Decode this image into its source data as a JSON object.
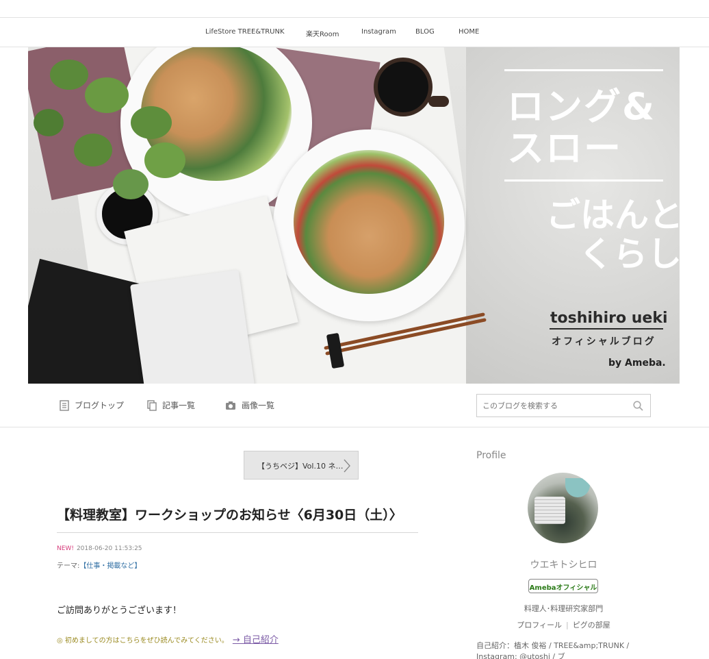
{
  "topnav": {
    "items": [
      "LifeStore TREE&TRUNK",
      "楽天Room",
      "Instagram",
      "BLOG",
      "HOME"
    ]
  },
  "hero": {
    "title_line1": "ロング&",
    "title_line2": "スロー",
    "title_line3": "ごはんと",
    "title_line4": "くらし",
    "author": "toshihiro ueki",
    "blog_label": "オフィシャルブログ",
    "by_label": "by Ameba."
  },
  "subnav": {
    "blog_top": "ブログトップ",
    "articles": "記事一覧",
    "images": "画像一覧",
    "search_placeholder": "このブログを検索する"
  },
  "article": {
    "next_label": "【うちベジ】Vol.10 ネ…",
    "title": "【料理教室】ワークショップのお知らせ〈6月30日（土）〉",
    "new_label": "NEW!",
    "datetime": "2018-06-20 11:53:25",
    "theme_prefix": "テーマ:",
    "theme_link": "【仕事・掲載など】",
    "greeting": "ご訪問ありがとうございます！",
    "intro_note": "◎ 初めましての方はこちらをぜひ読んでみてください。",
    "intro_link": "→ 自己紹介"
  },
  "sidebar": {
    "profile_heading": "Profile",
    "name": "ウエキトシヒロ",
    "badge": "Amebaオフィシャル",
    "category": "料理人･料理研究家部門",
    "link_profile": "プロフィール",
    "link_room": "ピグの部屋",
    "intro": "自己紹介：植木 俊裕 / TREE&amp;TRUNK / Instagram: @utoshi / ブ"
  },
  "colors": {
    "accent_new": "#d63a7a",
    "theme_link": "#2f6ea3",
    "badge_green": "#2a7a17",
    "intro_note": "#9a8a20",
    "intro_link": "#7b5aa6"
  }
}
